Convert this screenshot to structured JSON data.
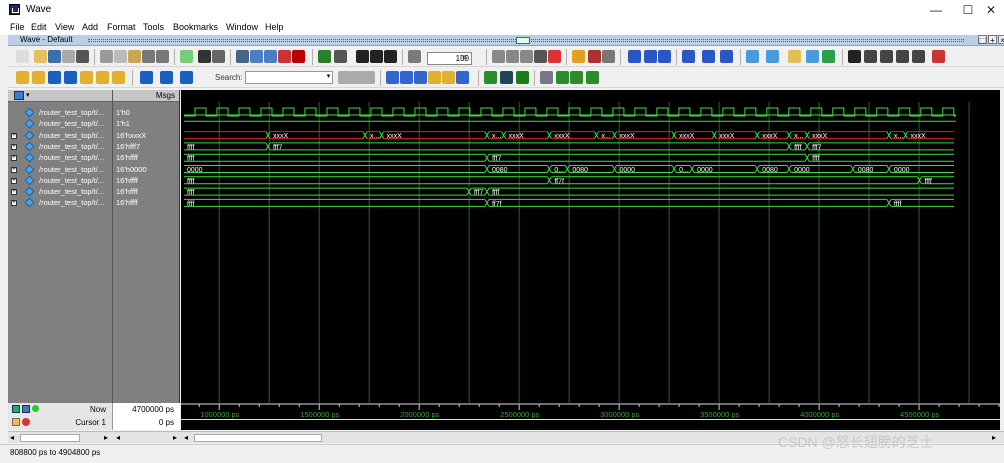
{
  "window": {
    "title": "Wave",
    "minimize": "—",
    "maximize": "☐",
    "close": "✕"
  },
  "menu": [
    "File",
    "Edit",
    "View",
    "Add",
    "Format",
    "Tools",
    "Bookmarks",
    "Window",
    "Help"
  ],
  "subwindow": {
    "title": "Wave - Default"
  },
  "toolbar": {
    "zoom_value": "100",
    "zoom_unit": "ns",
    "search_label": "Search:",
    "search_value": ""
  },
  "columns": {
    "messages_header": "Msgs"
  },
  "signals": [
    {
      "name": "/router_test_top/t/...",
      "value": "1'h0",
      "expandable": false
    },
    {
      "name": "/router_test_top/t/...",
      "value": "1'h1",
      "expandable": false
    },
    {
      "name": "/router_test_top/t/...",
      "value": "16'hxxxX",
      "expandable": true
    },
    {
      "name": "/router_test_top/t/...",
      "value": "16'hfff7",
      "expandable": true
    },
    {
      "name": "/router_test_top/t/...",
      "value": "16'hffff",
      "expandable": true
    },
    {
      "name": "/router_test_top/t/...",
      "value": "16'h0000",
      "expandable": true
    },
    {
      "name": "/router_test_top/t/...",
      "value": "16'hffff",
      "expandable": true
    },
    {
      "name": "/router_test_top/t/...",
      "value": "16'hffff",
      "expandable": true
    },
    {
      "name": "/router_test_top/t/...",
      "value": "16'hffff",
      "expandable": true
    }
  ],
  "waveform": {
    "time_start_ps": 808800,
    "time_end_ps": 4904800,
    "clock_period_ps": 110000,
    "bus_rows": [
      {
        "start_label": "",
        "segments": [
          [
            "1400000",
            "xxxX"
          ],
          [
            "2100000",
            "x..."
          ],
          [
            "2220000",
            "xxxX"
          ],
          [
            "2980000",
            "x..."
          ],
          [
            "3100000",
            "xxxX"
          ],
          [
            "3430000",
            "xxxX"
          ],
          [
            "3770000",
            "x..."
          ],
          [
            "3900000",
            "xxxX"
          ],
          [
            "4330000",
            "xxxX"
          ],
          [
            "4620000",
            "xxxX"
          ],
          [
            "4930000",
            "xxxX"
          ],
          [
            "5160000",
            "x..."
          ],
          [
            "5290000",
            "xxxX"
          ],
          [
            "5880000",
            "x..."
          ],
          [
            "6000000",
            "xxxX"
          ]
        ]
      },
      {
        "start_label": "ffff",
        "segments": [
          [
            "1400000",
            "fff7"
          ],
          [
            "5160000",
            "ffff"
          ],
          [
            "5290000",
            "fff7"
          ]
        ]
      },
      {
        "start_label": "ffff",
        "segments": [
          [
            "2980000",
            "fff7"
          ],
          [
            "5290000",
            "ffff"
          ]
        ]
      },
      {
        "start_label": "0000",
        "segments": [
          [
            "2980000",
            "0080"
          ],
          [
            "3430000",
            "0..."
          ],
          [
            "3560000",
            "0080"
          ],
          [
            "3900000",
            "0000"
          ],
          [
            "4330000",
            "0..."
          ],
          [
            "4460000",
            "0000"
          ],
          [
            "4930000",
            "0080"
          ],
          [
            "5160000",
            "0000"
          ],
          [
            "5620000",
            "0080"
          ],
          [
            "5880000",
            "0000"
          ]
        ]
      },
      {
        "start_label": "ffff",
        "segments": [
          [
            "3430000",
            "ff7f"
          ],
          [
            "6100000",
            "ffff"
          ]
        ]
      },
      {
        "start_label": "ffff",
        "segments": [
          [
            "2850000",
            "fff7"
          ],
          [
            "2980000",
            "ffff"
          ]
        ]
      },
      {
        "start_label": "ffff",
        "segments": [
          [
            "2980000",
            "ff7f"
          ],
          [
            "5880000",
            "ffff"
          ]
        ]
      }
    ],
    "axis_ticks": [
      "1000000 ps",
      "1500000 ps",
      "2000000 ps",
      "2500000 ps",
      "3000000 ps",
      "3500000 ps",
      "4000000 ps",
      "4500000 ps"
    ]
  },
  "now": {
    "label": "Now",
    "value": "4700000 ps"
  },
  "cursor": {
    "label": "Cursor 1",
    "value": "0 ps"
  },
  "status": {
    "range": "808800 ps to 4904800 ps"
  },
  "watermark": "CSDN @怒长翅膀的芝士",
  "colors": {
    "wave_bg": "#000000",
    "signal_green": "#3adf3a",
    "undefined_red": "#e02020",
    "panel_gray": "#808080",
    "grid": "#2f5f2f",
    "axis_text": "#3aa03a"
  }
}
